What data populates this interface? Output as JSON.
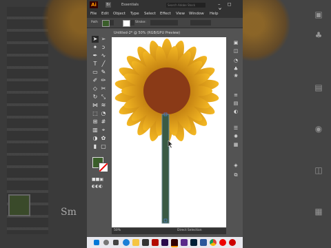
{
  "app": {
    "logo": "Ai",
    "bridge": "Br",
    "workspace": "Essentials",
    "search_placeholder": "Search Adobe Stock",
    "window_controls": "– ◻ ✕"
  },
  "menus": [
    "File",
    "Edit",
    "Object",
    "Type",
    "Select",
    "Effect",
    "View",
    "Window",
    "Help"
  ],
  "control_bar": {
    "selection_label": "Path",
    "stroke_label": "Stroke:"
  },
  "document": {
    "tab_title": "Untitled-2* @ 50% (RGB/GPU Preview)",
    "zoom": "50%",
    "status": "Direct Selection"
  },
  "colors": {
    "petal_light": "#f2b51e",
    "petal_dark": "#b06a08",
    "center": "#8a3a17",
    "stem": "#3a5a44",
    "fill": "#3a5e2a"
  },
  "background_text": "Sm",
  "tools": [
    "selection-icon",
    "direct-selection-icon",
    "magic-wand-icon",
    "lasso-icon",
    "pen-icon",
    "curvature-icon",
    "type-icon",
    "line-icon",
    "rectangle-icon",
    "paintbrush-icon",
    "shaper-icon",
    "pencil-icon",
    "eraser-icon",
    "scissors-icon",
    "rotate-icon",
    "scale-icon",
    "width-icon",
    "warp-icon",
    "free-transform-icon",
    "shape-builder-icon",
    "perspective-icon",
    "mesh-icon",
    "gradient-icon",
    "eyedropper-icon",
    "blend-icon",
    "symbol-sprayer-icon",
    "graph-icon",
    "artboard-icon",
    "slice-icon",
    "hand-icon",
    "zoom-icon"
  ],
  "taskbar_icons": [
    "windows-icon",
    "search-icon",
    "task-view-icon",
    "edge-icon",
    "file-explorer-icon",
    "store-icon",
    "acrobat-icon",
    "premiere-icon",
    "illustrator-icon",
    "media-icon",
    "photoshop-icon",
    "word-icon",
    "chrome-icon",
    "opera-icon",
    "settings-icon"
  ]
}
